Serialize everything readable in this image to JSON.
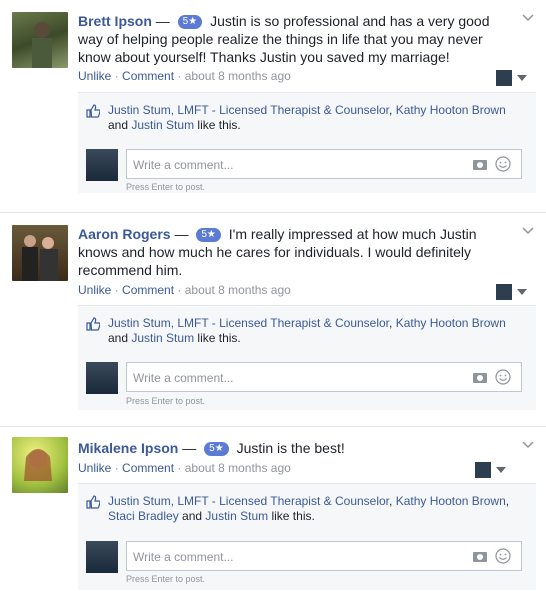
{
  "reviews": [
    {
      "name": "Brett Ipson",
      "dash": "—",
      "stars": "5★",
      "text": "Justin is so professional and has a very good way of helping people realize the things in life that you may never know about yourself! Thanks Justin you saved my marriage!",
      "unlike": "Unlike",
      "comment": "Comment",
      "time": "about 8 months ago",
      "likers": [
        "Justin Stum, LMFT - Licensed Therapist & Counselor",
        "Kathy Hooton Brown",
        "Justin Stum"
      ],
      "likes_suffix": "like this.",
      "comment_placeholder": "Write a comment...",
      "press_enter": "Press Enter to post."
    },
    {
      "name": "Aaron Rogers",
      "dash": "—",
      "stars": "5★",
      "text": "I'm really impressed at how much Justin knows and how much he cares for individuals. I would definitely recommend him.",
      "unlike": "Unlike",
      "comment": "Comment",
      "time": "about 8 months ago",
      "likers": [
        "Justin Stum, LMFT - Licensed Therapist & Counselor",
        "Kathy Hooton Brown",
        "Justin Stum"
      ],
      "likes_suffix": "like this.",
      "comment_placeholder": "Write a comment...",
      "press_enter": "Press Enter to post."
    },
    {
      "name": "Mikalene Ipson",
      "dash": "—",
      "stars": "5★",
      "text": "Justin is the best!",
      "unlike": "Unlike",
      "comment": "Comment",
      "time": "about 8 months ago",
      "likers": [
        "Justin Stum, LMFT - Licensed Therapist & Counselor",
        "Kathy Hooton Brown",
        "Staci Bradley",
        "Justin Stum"
      ],
      "likes_suffix": "like this.",
      "comment_placeholder": "Write a comment...",
      "press_enter": "Press Enter to post."
    }
  ],
  "separators": {
    "comma": ",",
    "and": "and",
    "middot": "·"
  },
  "colors": {
    "link": "#3b5998",
    "badge": "#5b7bd5",
    "meta": "#90949c",
    "panel": "#f6f7f9"
  }
}
